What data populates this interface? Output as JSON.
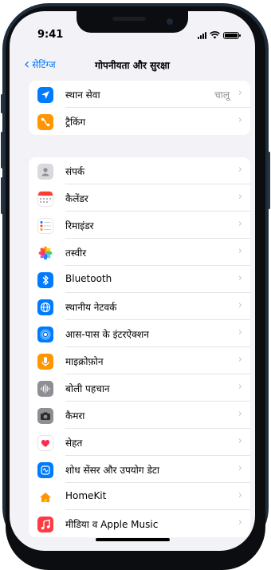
{
  "status": {
    "time": "9:41"
  },
  "nav": {
    "back_label": "सेटिंग्ज",
    "title": "गोपनीयता और सुरक्षा"
  },
  "group1": [
    {
      "label": "स्थान सेवा",
      "value": "चालू",
      "icon": "location-arrow-icon",
      "color": "#007aff"
    },
    {
      "label": "ट्रैकिंग",
      "value": "",
      "icon": "tracking-icon",
      "color": "#ff9500"
    }
  ],
  "group2": [
    {
      "label": "संपर्क",
      "icon": "contacts-icon",
      "color": "#d9d9de"
    },
    {
      "label": "कैलेंडर",
      "icon": "calendar-icon",
      "color": "#ffffff"
    },
    {
      "label": "रिमाइंडर",
      "icon": "reminders-icon",
      "color": "#ffffff"
    },
    {
      "label": "तस्वीर",
      "icon": "photos-icon",
      "color": "#ffffff"
    },
    {
      "label": "Bluetooth",
      "icon": "bluetooth-icon",
      "color": "#007aff"
    },
    {
      "label": "स्थानीय नेटवर्क",
      "icon": "globe-icon",
      "color": "#007aff"
    },
    {
      "label": "आस-पास के इंटरऐक्शन",
      "icon": "nearby-icon",
      "color": "#007aff"
    },
    {
      "label": "माइक्रोफ़ोन",
      "icon": "microphone-icon",
      "color": "#ff9500"
    },
    {
      "label": "बोली पहचान",
      "icon": "speech-recognition-icon",
      "color": "#8e8e93"
    },
    {
      "label": "कैमरा",
      "icon": "camera-icon",
      "color": "#8e8e93"
    },
    {
      "label": "सेहत",
      "icon": "health-heart-icon",
      "color": "#ffffff"
    },
    {
      "label": "शोध सेंसर और उपयोग डेटा",
      "icon": "research-sensor-icon",
      "color": "#007aff"
    },
    {
      "label": "HomeKit",
      "icon": "home-icon",
      "color": "#ffffff"
    },
    {
      "label": "मीडिया व Apple Music",
      "icon": "music-note-icon",
      "color": "#fc3c44"
    }
  ]
}
